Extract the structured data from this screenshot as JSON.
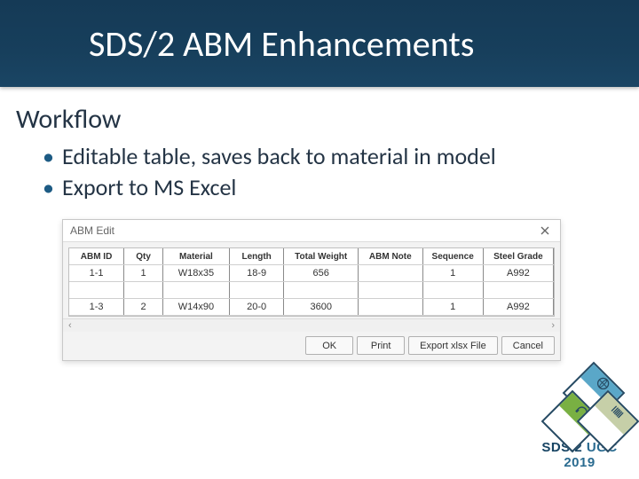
{
  "title": "SDS/2 ABM Enhancements",
  "subtitle": "Workflow",
  "bullets": [
    "Editable table, saves back to material in model",
    "Export to MS Excel"
  ],
  "dialog": {
    "title": "ABM Edit",
    "columns": [
      "ABM ID",
      "Qty",
      "Material",
      "Length",
      "Total Weight",
      "ABM Note",
      "Sequence",
      "Steel Grade"
    ],
    "rows": [
      {
        "id": "1-1",
        "qty": "1",
        "mat": "W18x35",
        "len": "18-9",
        "wt": "656",
        "note": "",
        "seq": "1",
        "grade": "A992"
      },
      {
        "id": "1-3",
        "qty": "2",
        "mat": "W14x90",
        "len": "20-0",
        "wt": "3600",
        "note": "",
        "seq": "1",
        "grade": "A992"
      }
    ],
    "buttons": {
      "ok": "OK",
      "print": "Print",
      "export": "Export xlsx File",
      "cancel": "Cancel"
    }
  },
  "logo": {
    "line_a": "SDS/2",
    "line_b": " UGC 2019"
  }
}
